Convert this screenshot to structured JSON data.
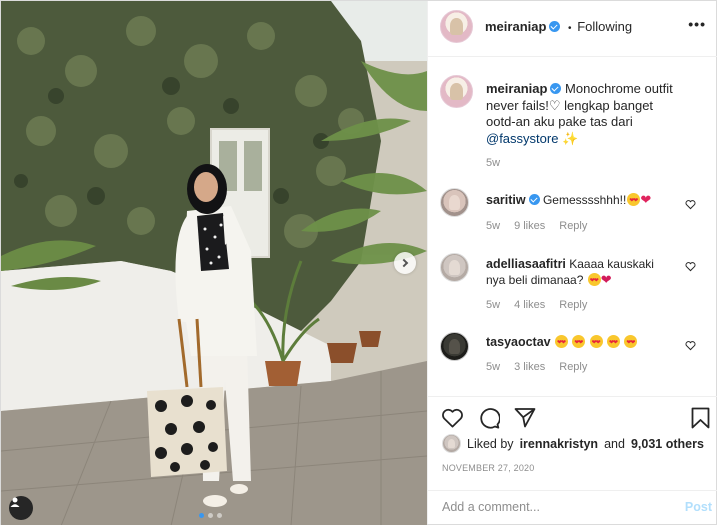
{
  "header": {
    "username": "meiraniap",
    "separator": "•",
    "follow_status": "Following"
  },
  "caption": {
    "username": "meiraniap",
    "text": "Monochrome outfit never fails!♡ lengkap banget ootd-an aku pake tas dari",
    "mention": "@fassystore",
    "trailing_emoji": "✨",
    "time": "5w"
  },
  "comments": [
    {
      "username": "saritiw",
      "verified": true,
      "text": "Gemesssshhh!!",
      "time": "5w",
      "likes": "9 likes",
      "reply": "Reply"
    },
    {
      "username": "adelliasaafitri",
      "verified": false,
      "text": "Kaaaa kauskaki nya beli dimanaa?",
      "time": "5w",
      "likes": "4 likes",
      "reply": "Reply"
    },
    {
      "username": "tasyaoctav",
      "verified": false,
      "text": "",
      "time": "5w",
      "likes": "3 likes",
      "reply": "Reply"
    }
  ],
  "likes": {
    "prefix": "Liked by",
    "user": "irennakristyn",
    "conjunction": "and",
    "others": "9,031 others"
  },
  "post_date": "NOVEMBER 27, 2020",
  "add_comment": {
    "placeholder": "Add a comment...",
    "post_label": "Post"
  },
  "carousel": {
    "slide_count": 3,
    "active_index": 1
  },
  "colors": {
    "verified_blue": "#3897f0",
    "mention": "#00376b",
    "muted": "#8e8e8e",
    "post_button_disabled": "#b2dffc",
    "text": "#262626"
  },
  "icons": [
    "more-icon",
    "heart-icon",
    "comment-icon",
    "share-icon",
    "bookmark-icon",
    "user-tag-icon",
    "chevron-right-icon",
    "verified-badge-icon"
  ]
}
